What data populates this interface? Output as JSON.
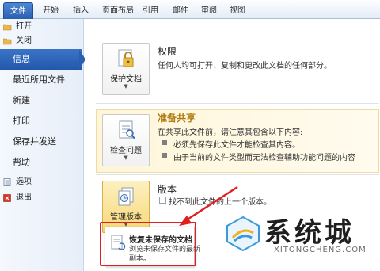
{
  "ribbon": {
    "tabs": [
      "文件",
      "开始",
      "插入",
      "页面布局",
      "引用",
      "邮件",
      "审阅",
      "视图"
    ]
  },
  "nav": {
    "open": "打开",
    "close": "关闭",
    "info": "信息",
    "recent": "最近所用文件",
    "new": "新建",
    "print": "打印",
    "save_send": "保存并发送",
    "help": "帮助",
    "options": "选项",
    "exit": "退出"
  },
  "permissions": {
    "button_label": "保护文档",
    "title": "权限",
    "desc": "任何人均可打开、复制和更改此文档的任何部分。"
  },
  "prepare": {
    "button_label": "检查问题",
    "title": "准备共享",
    "desc": "在共享此文件前，请注意其包含以下内容:",
    "bullets": [
      "必须先保存此文件才能检查其内容。",
      "由于当前的文件类型而无法检查辅助功能问题的内容"
    ]
  },
  "versions": {
    "button_label": "管理版本",
    "title": "版本",
    "desc": "找不到此文件的上一个版本。"
  },
  "dropdown": {
    "title": "恢复未保存的文档",
    "desc": "浏览未保存文件的最新副本。"
  },
  "watermark": {
    "text": "系统城",
    "sub": "XITONGCHENG.COM"
  },
  "colors": {
    "accent": "#2a5fb0",
    "highlight_border": "#e02020",
    "highlight_bg": "#fff6d9"
  }
}
